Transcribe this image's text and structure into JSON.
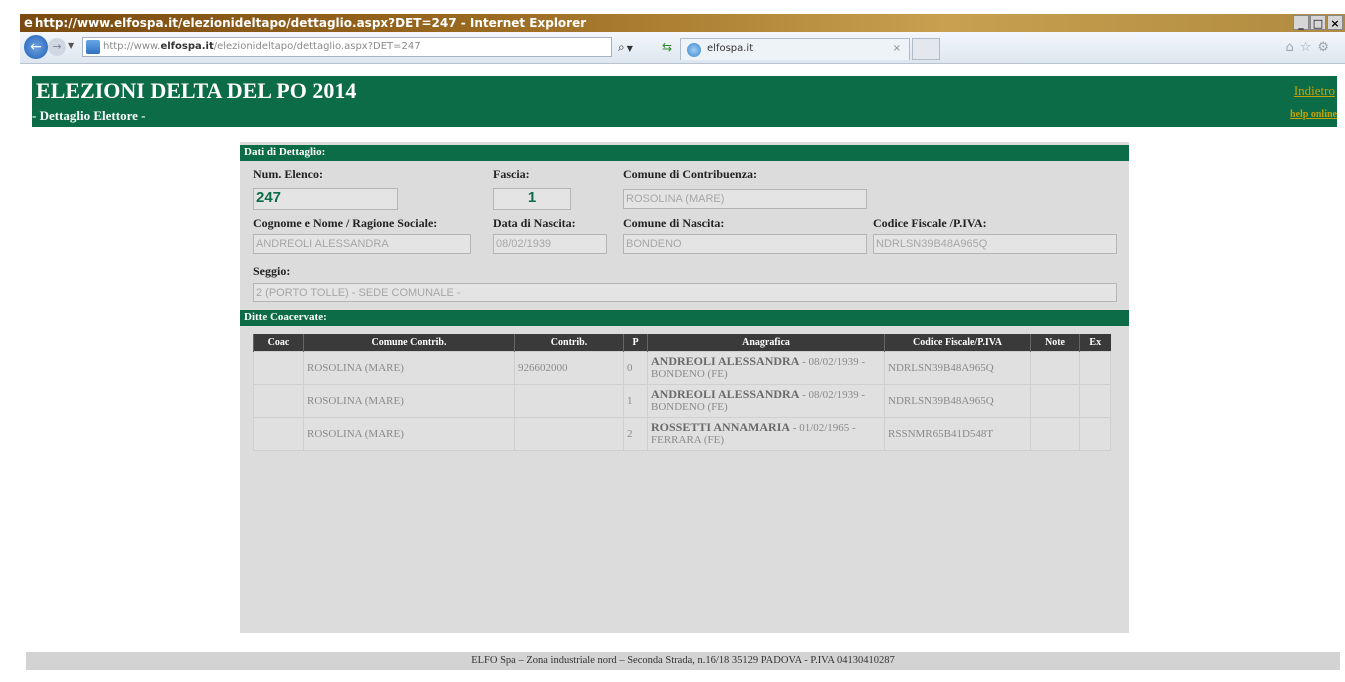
{
  "browser": {
    "title": "http://www.elfospa.it/elezionideltapo/dettaglio.aspx?DET=247 - Internet Explorer",
    "window_buttons": [
      "_",
      "□",
      "×"
    ],
    "address_prefix": "http://www.",
    "address_domain": "elfospa.it",
    "address_path": "/elezionideltapo/dettaglio.aspx?DET=247",
    "search_icon": "⌕",
    "tab_label": "elfospa.it",
    "tab_close": "×",
    "right_icons": "⌂☆⚙"
  },
  "header": {
    "title": "ELEZIONI DELTA DEL PO 2014",
    "subtitle": "- Dettaglio Elettore -",
    "back_link": "Indietro",
    "help_link": "help online"
  },
  "details": {
    "section_title": "Dati di Dettaglio:",
    "num_elenco_label": "Num. Elenco:",
    "num_elenco_value": "247",
    "fascia_label": "Fascia:",
    "fascia_value": "1",
    "comune_contribuenza_label": "Comune di Contribuenza:",
    "comune_contribuenza_value": "ROSOLINA (MARE)",
    "cognome_nome_label": "Cognome e Nome / Ragione Sociale:",
    "cognome_nome_value": "ANDREOLI ALESSANDRA",
    "data_nascita_label": "Data di Nascita:",
    "data_nascita_value": "08/02/1939",
    "comune_nascita_label": "Comune di Nascita:",
    "comune_nascita_value": "BONDENO",
    "codice_fiscale_label": "Codice Fiscale /P.IVA:",
    "codice_fiscale_value": "NDRLSN39B48A965Q",
    "seggio_label": "Seggio:",
    "seggio_value": "2 (PORTO TOLLE) - SEDE COMUNALE -"
  },
  "ditte": {
    "section_title": "Ditte Coacervate:",
    "columns": [
      "Coac",
      "Comune Contrib.",
      "Contrib.",
      "P",
      "Anagrafica",
      "Codice Fiscale/P.IVA",
      "Note",
      "Ex"
    ],
    "rows": [
      {
        "coac": "",
        "comune": "ROSOLINA (MARE)",
        "contrib": "926602000",
        "p": "0",
        "anag_name": "ANDREOLI ALESSANDRA",
        "anag_rest": " - 08/02/1939 - BONDENO (FE)",
        "cf": "NDRLSN39B48A965Q",
        "note": "",
        "ex": ""
      },
      {
        "coac": "",
        "comune": "ROSOLINA (MARE)",
        "contrib": "",
        "p": "1",
        "anag_name": "ANDREOLI ALESSANDRA",
        "anag_rest": " - 08/02/1939 - BONDENO (FE)",
        "cf": "NDRLSN39B48A965Q",
        "note": "",
        "ex": ""
      },
      {
        "coac": "",
        "comune": "ROSOLINA (MARE)",
        "contrib": "",
        "p": "2",
        "anag_name": "ROSSETTI ANNAMARIA",
        "anag_rest": " - 01/02/1965 - FERRARA (FE)",
        "cf": "RSSNMR65B41D548T",
        "note": "",
        "ex": ""
      }
    ]
  },
  "footer": {
    "text": "ELFO Spa – Zona industriale nord – Seconda Strada, n.16/18 35129 PADOVA - P.IVA 04130410287"
  }
}
